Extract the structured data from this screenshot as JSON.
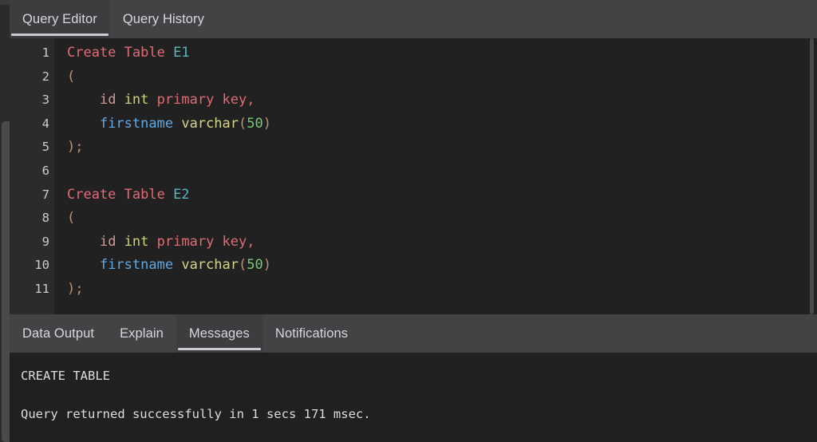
{
  "editor_tabs": [
    {
      "label": "Query Editor",
      "active": true
    },
    {
      "label": "Query History",
      "active": false
    }
  ],
  "result_tabs": [
    {
      "label": "Data Output",
      "active": false
    },
    {
      "label": "Explain",
      "active": false
    },
    {
      "label": "Messages",
      "active": true
    },
    {
      "label": "Notifications",
      "active": false
    }
  ],
  "editor": {
    "line_numbers": [
      "1",
      "2",
      "3",
      "4",
      "5",
      "6",
      "7",
      "8",
      "9",
      "10",
      "11"
    ],
    "lines": [
      {
        "n": "1",
        "tokens": [
          {
            "t": "Create Table ",
            "c": "tok-kw"
          },
          {
            "t": "E1",
            "c": "tok-id"
          }
        ]
      },
      {
        "n": "2",
        "tokens": [
          {
            "t": "(",
            "c": "tok-punct"
          }
        ]
      },
      {
        "n": "3",
        "tokens": [
          {
            "t": "    ",
            "c": ""
          },
          {
            "t": "id",
            "c": "tok-col"
          },
          {
            "t": " ",
            "c": ""
          },
          {
            "t": "int",
            "c": "tok-type"
          },
          {
            "t": " ",
            "c": ""
          },
          {
            "t": "primary key,",
            "c": "tok-kw"
          }
        ]
      },
      {
        "n": "4",
        "tokens": [
          {
            "t": "    ",
            "c": ""
          },
          {
            "t": "firstname",
            "c": "tok-field"
          },
          {
            "t": " ",
            "c": ""
          },
          {
            "t": "varchar",
            "c": "tok-type2"
          },
          {
            "t": "(",
            "c": "tok-punct"
          },
          {
            "t": "50",
            "c": "tok-num"
          },
          {
            "t": ")",
            "c": "tok-punct"
          }
        ]
      },
      {
        "n": "5",
        "tokens": [
          {
            "t": ");",
            "c": "tok-punct"
          }
        ]
      },
      {
        "n": "6",
        "tokens": [
          {
            "t": "",
            "c": ""
          }
        ]
      },
      {
        "n": "7",
        "tokens": [
          {
            "t": "Create Table ",
            "c": "tok-kw"
          },
          {
            "t": "E2",
            "c": "tok-id"
          }
        ]
      },
      {
        "n": "8",
        "tokens": [
          {
            "t": "(",
            "c": "tok-punct"
          }
        ]
      },
      {
        "n": "9",
        "tokens": [
          {
            "t": "    ",
            "c": ""
          },
          {
            "t": "id",
            "c": "tok-col"
          },
          {
            "t": " ",
            "c": ""
          },
          {
            "t": "int",
            "c": "tok-type"
          },
          {
            "t": " ",
            "c": ""
          },
          {
            "t": "primary key,",
            "c": "tok-kw"
          }
        ]
      },
      {
        "n": "10",
        "tokens": [
          {
            "t": "    ",
            "c": ""
          },
          {
            "t": "firstname",
            "c": "tok-field"
          },
          {
            "t": " ",
            "c": ""
          },
          {
            "t": "varchar",
            "c": "tok-type2"
          },
          {
            "t": "(",
            "c": "tok-punct"
          },
          {
            "t": "50",
            "c": "tok-num"
          },
          {
            "t": ")",
            "c": "tok-punct"
          }
        ]
      },
      {
        "n": "11",
        "tokens": [
          {
            "t": ");",
            "c": "tok-punct"
          }
        ]
      }
    ],
    "raw_sql": "Create Table E1\n(\n    id int primary key,\n    firstname varchar(50)\n);\n\nCreate Table E2\n(\n    id int primary key,\n    firstname varchar(50)\n);"
  },
  "messages": {
    "lines": [
      "CREATE TABLE",
      "",
      "Query returned successfully in 1 secs 171 msec."
    ],
    "command_tag": "CREATE TABLE",
    "status_text": "Query returned successfully in 1 secs 171 msec.",
    "duration": "1 secs 171 msec"
  },
  "colors": {
    "tabbar_bg": "#414345",
    "active_tab_bg": "#3b3d3f",
    "active_tab_underline": "#c9cdd0",
    "editor_bg": "#212121",
    "gutter_bg": "#2b2b2b",
    "output_bg": "#202020",
    "keyword": "#e06c75",
    "identifier": "#56b6c2",
    "column": "#d19a9a",
    "type": "#cdd178",
    "field": "#61a8e0",
    "number": "#78c878",
    "punct": "#c09070"
  }
}
